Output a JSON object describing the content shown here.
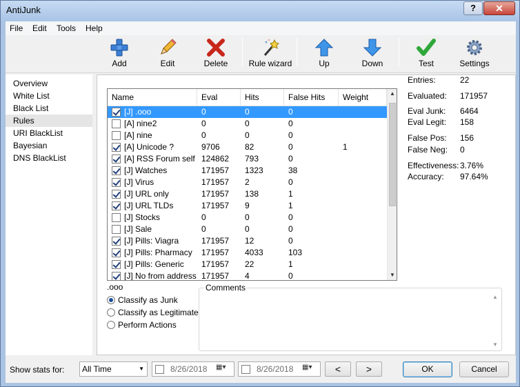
{
  "window": {
    "title": "AntiJunk"
  },
  "menu": [
    "File",
    "Edit",
    "Tools",
    "Help"
  ],
  "toolbar": [
    {
      "label": "Add",
      "icon": "add-icon"
    },
    {
      "label": "Edit",
      "icon": "pencil-icon"
    },
    {
      "label": "Delete",
      "icon": "delete-icon"
    },
    {
      "label": "Rule wizard",
      "icon": "wand-icon"
    },
    {
      "label": "Up",
      "icon": "arrow-up-icon"
    },
    {
      "label": "Down",
      "icon": "arrow-down-icon"
    },
    {
      "label": "Test",
      "icon": "checkmark-icon"
    },
    {
      "label": "Settings",
      "icon": "gear-icon"
    }
  ],
  "nav": [
    "Overview",
    "White List",
    "Black List",
    "Rules",
    "URI BlackList",
    "Bayesian",
    "DNS BlackList"
  ],
  "rules_table": {
    "columns": [
      "Name",
      "Eval",
      "Hits",
      "False Hits",
      "Weight"
    ],
    "rows": [
      {
        "checked": true,
        "name": "[J] .ooo",
        "eval": "0",
        "hits": "0",
        "false_hits": "0",
        "weight": ""
      },
      {
        "checked": false,
        "name": "[A] nine2",
        "eval": "0",
        "hits": "0",
        "false_hits": "0",
        "weight": ""
      },
      {
        "checked": false,
        "name": "[A] nine",
        "eval": "0",
        "hits": "0",
        "false_hits": "0",
        "weight": ""
      },
      {
        "checked": true,
        "name": "[A] Unicode ?",
        "eval": "9706",
        "hits": "82",
        "false_hits": "0",
        "weight": "1"
      },
      {
        "checked": true,
        "name": "[A] RSS Forum self",
        "eval": "124862",
        "hits": "793",
        "false_hits": "0",
        "weight": ""
      },
      {
        "checked": true,
        "name": "[J] Watches",
        "eval": "171957",
        "hits": "1323",
        "false_hits": "38",
        "weight": ""
      },
      {
        "checked": true,
        "name": "[J] Virus",
        "eval": "171957",
        "hits": "2",
        "false_hits": "0",
        "weight": ""
      },
      {
        "checked": true,
        "name": "[J] URL only",
        "eval": "171957",
        "hits": "138",
        "false_hits": "1",
        "weight": ""
      },
      {
        "checked": true,
        "name": "[J] URL TLDs",
        "eval": "171957",
        "hits": "9",
        "false_hits": "1",
        "weight": ""
      },
      {
        "checked": false,
        "name": "[J] Stocks",
        "eval": "0",
        "hits": "0",
        "false_hits": "0",
        "weight": ""
      },
      {
        "checked": false,
        "name": "[J] Sale",
        "eval": "0",
        "hits": "0",
        "false_hits": "0",
        "weight": ""
      },
      {
        "checked": true,
        "name": "[J] Pills: Viagra",
        "eval": "171957",
        "hits": "12",
        "false_hits": "0",
        "weight": ""
      },
      {
        "checked": true,
        "name": "[J] Pills: Pharmacy",
        "eval": "171957",
        "hits": "4033",
        "false_hits": "103",
        "weight": ""
      },
      {
        "checked": true,
        "name": "[J] Pills: Generic",
        "eval": "171957",
        "hits": "22",
        "false_hits": "1",
        "weight": ""
      },
      {
        "checked": true,
        "name": "[J] No from address",
        "eval": "171957",
        "hits": "4",
        "false_hits": "0",
        "weight": ""
      }
    ]
  },
  "stats": [
    {
      "label": "Entries:",
      "value": "22"
    },
    {
      "label": "Evaluated:",
      "value": "171957"
    },
    {
      "label": "Eval Junk:",
      "value": "6464"
    },
    {
      "label": "Eval Legit:",
      "value": "158"
    },
    {
      "label": "False Pos:",
      "value": "156"
    },
    {
      "label": "False Neg:",
      "value": "0"
    },
    {
      "label": "Effectiveness:",
      "value": "3.76%"
    },
    {
      "label": "Accuracy:",
      "value": "97.64%"
    }
  ],
  "selected_rule": ".ooo",
  "actions": [
    {
      "label": "Classify as Junk",
      "selected": true
    },
    {
      "label": "Classify as Legitimate",
      "selected": false
    },
    {
      "label": "Perform Actions",
      "selected": false
    }
  ],
  "comments": {
    "legend": "Comments",
    "value": ""
  },
  "bottom": {
    "show_stats_label": "Show stats for:",
    "period": "All Time",
    "date_from": "8/26/2018",
    "date_to": "8/26/2018",
    "prev": "<",
    "next": ">",
    "ok": "OK",
    "cancel": "Cancel"
  },
  "colors": {
    "selection": "#3399ff",
    "title_bar": "#aac3e2",
    "close_button": "#c8453a"
  }
}
